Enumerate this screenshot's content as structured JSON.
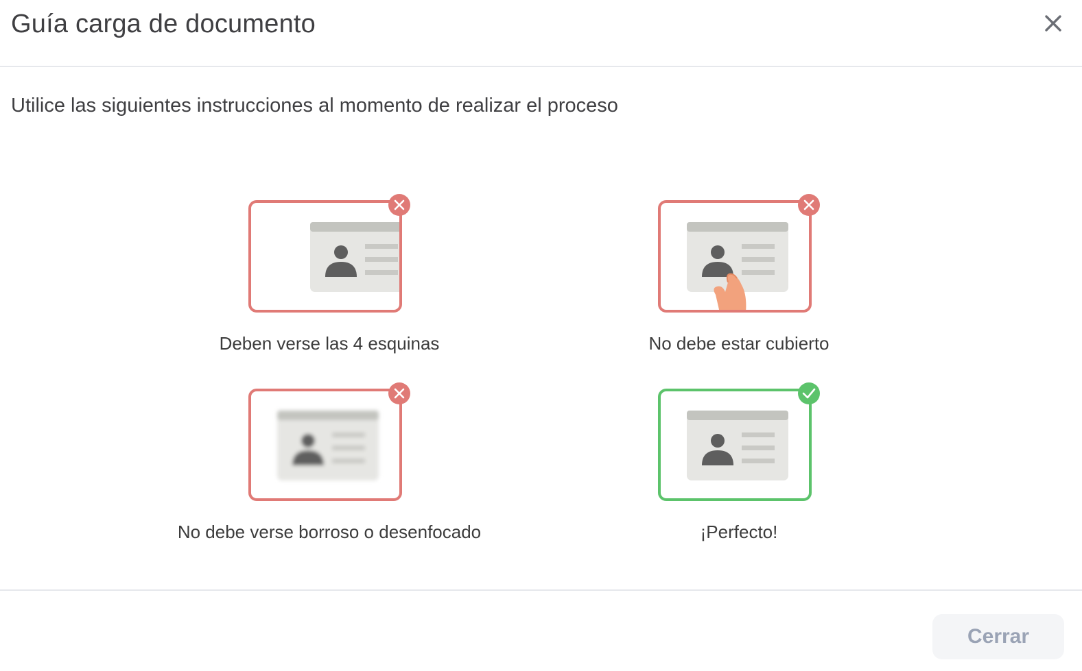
{
  "header": {
    "title": "Guía carga de documento",
    "close_icon": "close-icon"
  },
  "subtitle": "Utilice las siguientes instrucciones al momento de realizar el proceso",
  "guides": [
    {
      "caption": "Deben verse las 4 esquinas",
      "status": "incorrect",
      "icon": "id-card-cropped-icon"
    },
    {
      "caption": "No debe estar cubierto",
      "status": "incorrect",
      "icon": "id-card-covered-icon"
    },
    {
      "caption": "No debe verse borroso o desenfocado",
      "status": "incorrect",
      "icon": "id-card-blurred-icon"
    },
    {
      "caption": "¡Perfecto!",
      "status": "correct",
      "icon": "id-card-correct-icon"
    }
  ],
  "colors": {
    "error": "#e07a76",
    "success": "#5cc36b",
    "card_bg": "#e6e6e3",
    "card_header": "#c3c4bf",
    "silhouette": "#5e5e5e"
  },
  "footer": {
    "close_label": "Cerrar"
  }
}
